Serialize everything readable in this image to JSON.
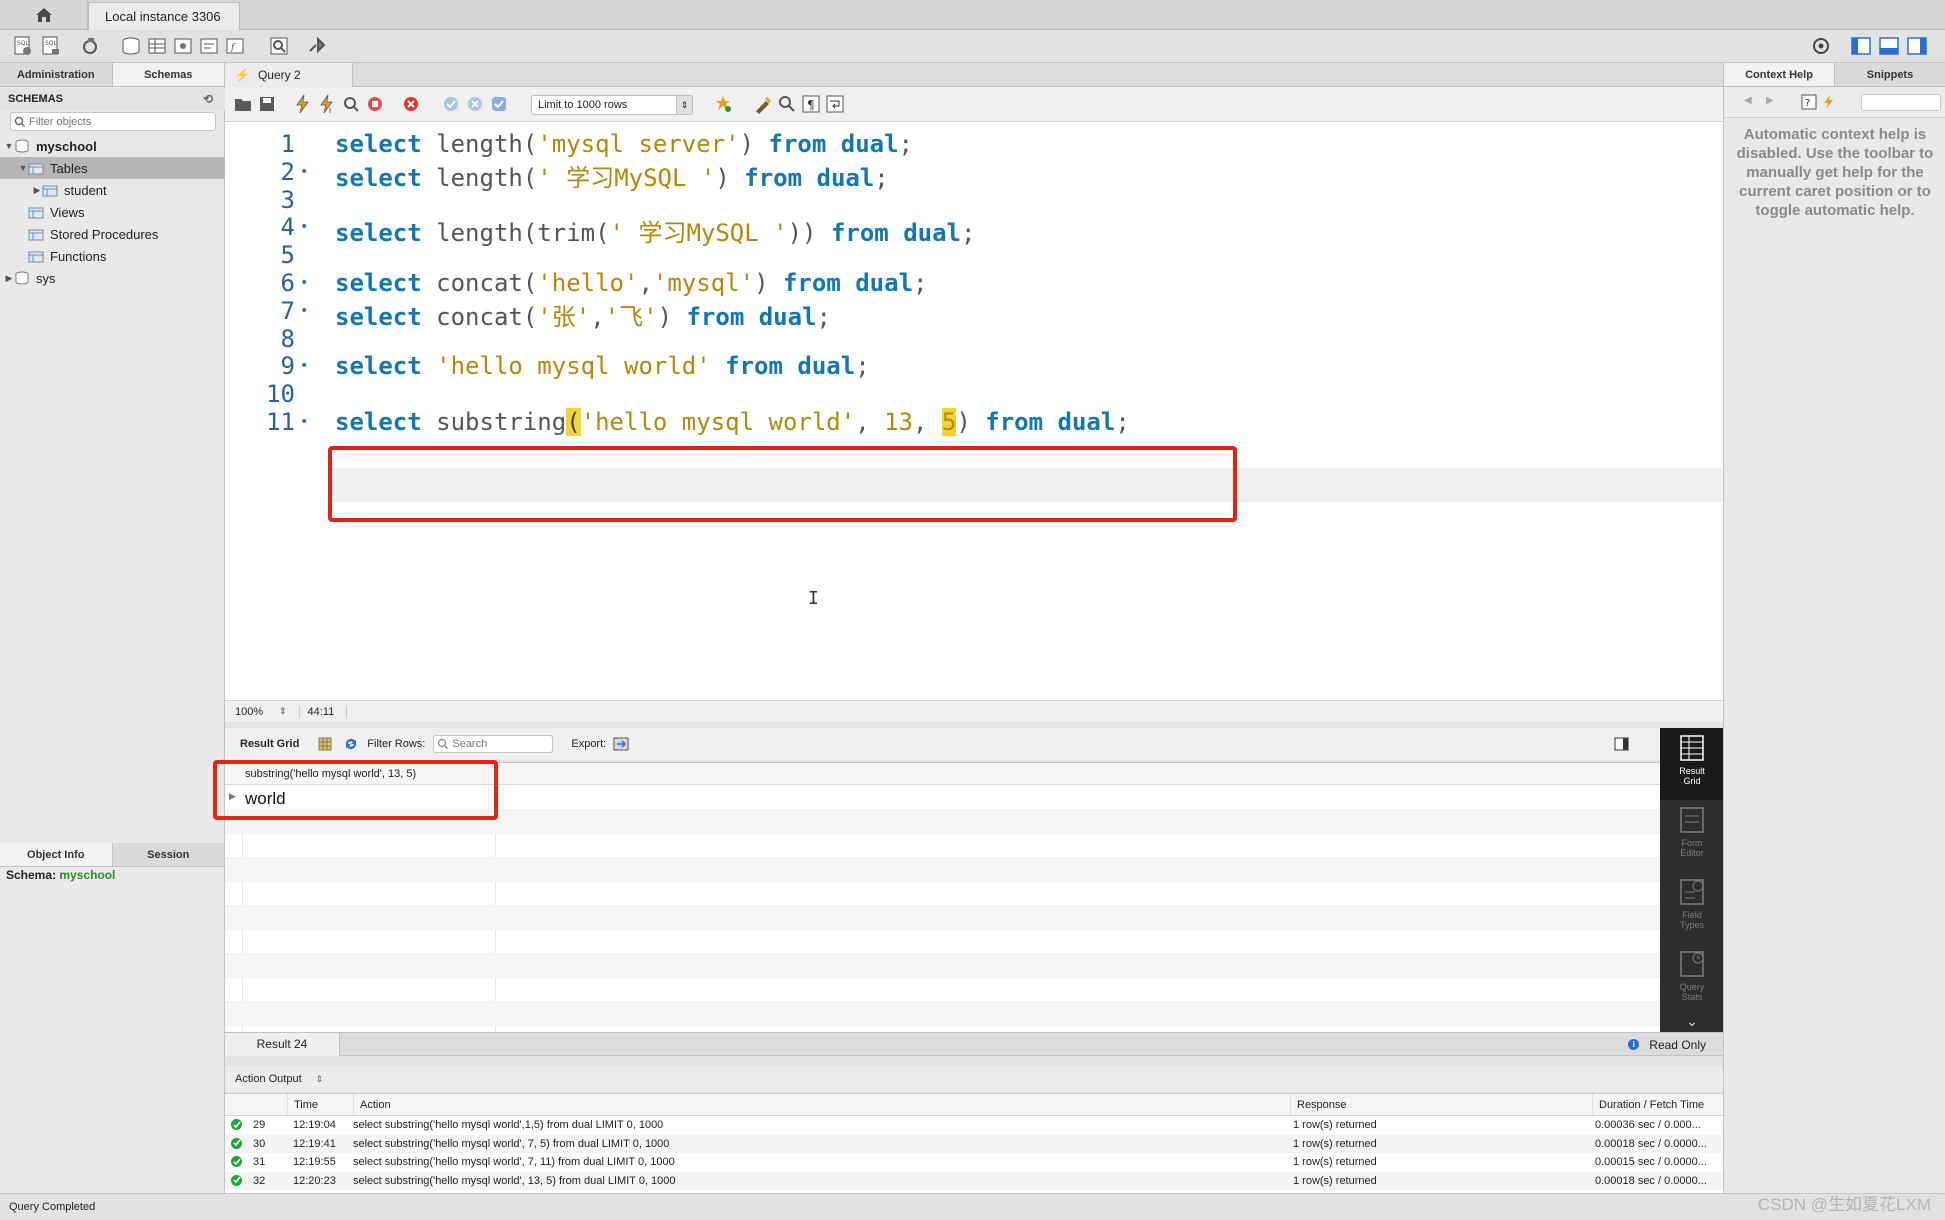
{
  "window": {
    "connection_tab": "Local instance 3306"
  },
  "left_panel": {
    "tabs": [
      "Administration",
      "Schemas"
    ],
    "header": "SCHEMAS",
    "filter_placeholder": "Filter objects",
    "tree": [
      {
        "label": "myschool",
        "level": 0,
        "twisty": "▼",
        "bold": true
      },
      {
        "label": "Tables",
        "level": 1,
        "twisty": "▼",
        "selected": true
      },
      {
        "label": "student",
        "level": 2,
        "twisty": "▶"
      },
      {
        "label": "Views",
        "level": 1,
        "twisty": ""
      },
      {
        "label": "Stored Procedures",
        "level": 1,
        "twisty": ""
      },
      {
        "label": "Functions",
        "level": 1,
        "twisty": ""
      },
      {
        "label": "sys",
        "level": 0,
        "twisty": "▶"
      }
    ],
    "info_tabs": [
      "Object Info",
      "Session"
    ],
    "schema_label": "Schema:",
    "schema_value": "myschool"
  },
  "editor": {
    "tab_title": "Query 2",
    "limit_select": "Limit to 1000 rows",
    "lines": [
      {
        "n": "1",
        "dot": false,
        "tokens": [
          [
            "kw",
            "select"
          ],
          [
            "fn",
            " length("
          ],
          [
            "st",
            "'mysql server'"
          ],
          [
            "fn",
            ") "
          ],
          [
            "kw",
            "from dual"
          ],
          [
            "fn",
            ";"
          ]
        ]
      },
      {
        "n": "2",
        "dot": true,
        "tokens": [
          [
            "kw",
            "select"
          ],
          [
            "fn",
            " length("
          ],
          [
            "st",
            "' 学习MySQL '"
          ],
          [
            "fn",
            ") "
          ],
          [
            "kw",
            "from dual"
          ],
          [
            "fn",
            ";"
          ]
        ]
      },
      {
        "n": "3",
        "dot": false,
        "tokens": []
      },
      {
        "n": "4",
        "dot": true,
        "tokens": [
          [
            "kw",
            "select"
          ],
          [
            "fn",
            " length(trim("
          ],
          [
            "st",
            "' 学习MySQL '"
          ],
          [
            "fn",
            ")) "
          ],
          [
            "kw",
            "from dual"
          ],
          [
            "fn",
            ";"
          ]
        ]
      },
      {
        "n": "5",
        "dot": false,
        "tokens": []
      },
      {
        "n": "6",
        "dot": true,
        "tokens": [
          [
            "kw",
            "select"
          ],
          [
            "fn",
            " concat("
          ],
          [
            "st",
            "'hello'"
          ],
          [
            "fn",
            ","
          ],
          [
            "st",
            "'mysql'"
          ],
          [
            "fn",
            ") "
          ],
          [
            "kw",
            "from dual"
          ],
          [
            "fn",
            ";"
          ]
        ]
      },
      {
        "n": "7",
        "dot": true,
        "tokens": [
          [
            "kw",
            "select"
          ],
          [
            "fn",
            " concat("
          ],
          [
            "st",
            "'张'"
          ],
          [
            "fn",
            ","
          ],
          [
            "st",
            "'飞'"
          ],
          [
            "fn",
            ") "
          ],
          [
            "kw",
            "from dual"
          ],
          [
            "fn",
            ";"
          ]
        ]
      },
      {
        "n": "8",
        "dot": false,
        "tokens": []
      },
      {
        "n": "9",
        "dot": true,
        "tokens": [
          [
            "kw",
            "select"
          ],
          [
            "fn",
            " "
          ],
          [
            "st",
            "'hello mysql world'"
          ],
          [
            "fn",
            " "
          ],
          [
            "kw",
            "from dual"
          ],
          [
            "fn",
            ";"
          ]
        ]
      },
      {
        "n": "10",
        "dot": false,
        "tokens": []
      },
      {
        "n": "11",
        "dot": true,
        "tokens": [
          [
            "kw",
            "select"
          ],
          [
            "fn",
            " substring"
          ],
          [
            "bh",
            "("
          ],
          [
            "st",
            "'hello mysql world'"
          ],
          [
            "fn",
            ", "
          ],
          [
            "nu",
            "13"
          ],
          [
            "fn",
            ", "
          ],
          [
            "bhn",
            "5"
          ],
          [
            "fn",
            ") "
          ],
          [
            "kw",
            "from dual"
          ],
          [
            "fn",
            ";"
          ]
        ]
      }
    ],
    "zoom": "100%",
    "cursor_pos": "44:11"
  },
  "result": {
    "tab_label": "Result Grid",
    "filter_label": "Filter Rows:",
    "search_placeholder": "Search",
    "export_label": "Export:",
    "column_header": "substring('hello mysql world', 13, 5)",
    "row_value": "world",
    "side_buttons": [
      "Result Grid",
      "Form Editor",
      "Field Types",
      "Query Stats"
    ],
    "result_tab": "Result 24",
    "read_only": "Read Only"
  },
  "output": {
    "selector": "Action Output",
    "columns": [
      "Time",
      "Action",
      "Response",
      "Duration / Fetch Time"
    ],
    "rows": [
      {
        "n": "29",
        "time": "12:19:04",
        "action": "select substring('hello mysql world',1,5) from dual LIMIT 0, 1000",
        "response": "1 row(s) returned",
        "duration": "0.00036 sec / 0.000..."
      },
      {
        "n": "30",
        "time": "12:19:41",
        "action": "select substring('hello mysql world', 7, 5) from dual LIMIT 0, 1000",
        "response": "1 row(s) returned",
        "duration": "0.00018 sec / 0.0000..."
      },
      {
        "n": "31",
        "time": "12:19:55",
        "action": "select substring('hello mysql world', 7, 11) from dual LIMIT 0, 1000",
        "response": "1 row(s) returned",
        "duration": "0.00015 sec / 0.0000..."
      },
      {
        "n": "32",
        "time": "12:20:23",
        "action": "select substring('hello mysql world', 13, 5) from dual LIMIT 0, 1000",
        "response": "1 row(s) returned",
        "duration": "0.00018 sec / 0.0000..."
      }
    ]
  },
  "right_panel": {
    "tabs": [
      "Context Help",
      "Snippets"
    ],
    "help_text": "Automatic context help is disabled. Use the toolbar to manually get help for the current caret position or to toggle automatic help."
  },
  "status": {
    "text": "Query Completed"
  },
  "watermark": "CSDN @生如夏花LXM",
  "colors": {
    "keyword": "#1277b3",
    "string": "#b8860b",
    "highlight_box": "#e2231a",
    "ok": "#23a23a"
  }
}
